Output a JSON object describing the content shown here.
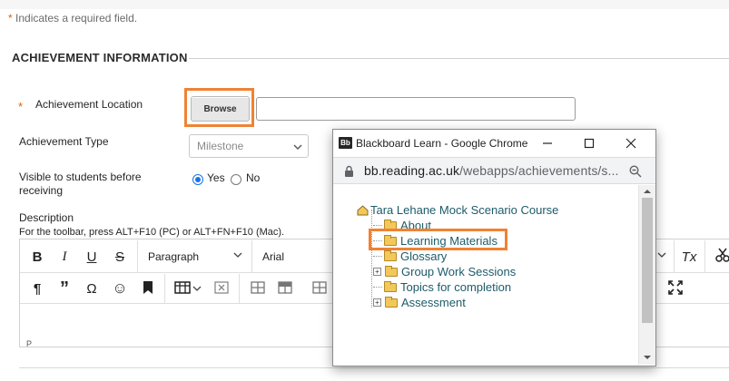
{
  "form": {
    "required_star": "*",
    "required_note": "Indicates a required field.",
    "section_title": "ACHIEVEMENT INFORMATION",
    "location_label": "Achievement Location",
    "browse_label": "Browse",
    "type_label": "Achievement Type",
    "type_value": "Milestone",
    "visible_label_line1": "Visible to students before",
    "visible_label_line2": "receiving",
    "yes_label": "Yes",
    "no_label": "No",
    "visible_selected": "Yes",
    "description_label": "Description",
    "toolbar_hint": "For the toolbar, press ALT+F10 (PC) or ALT+FN+F10 (Mac).",
    "editor_path": "P"
  },
  "editor_toolbar": {
    "row1": [
      "B",
      "I",
      "U",
      "S"
    ],
    "paragraph": "Paragraph",
    "font": "Arial",
    "row2": [
      "¶",
      "”",
      "Ω",
      "☺",
      "bookmark"
    ],
    "clear_format": "Tx"
  },
  "popup": {
    "window_title": "Blackboard Learn - Google Chrome",
    "logo_text": "Bb",
    "url_host": "bb.reading.ac.uk",
    "url_path": "/webapps/achievements/s...",
    "course": "Tara Lehane Mock Scenario Course",
    "items": [
      {
        "label": "About",
        "expandable": false
      },
      {
        "label": "Learning Materials",
        "expandable": false,
        "highlighted": true
      },
      {
        "label": "Glossary",
        "expandable": false
      },
      {
        "label": "Group Work Sessions",
        "expandable": true
      },
      {
        "label": "Topics for completion",
        "expandable": false
      },
      {
        "label": "Assessment",
        "expandable": true
      }
    ]
  },
  "colors": {
    "highlight": "#f08233",
    "required": "#d8630b",
    "tree_link": "#1d5b6a",
    "radio_selected": "#1a73e8"
  }
}
